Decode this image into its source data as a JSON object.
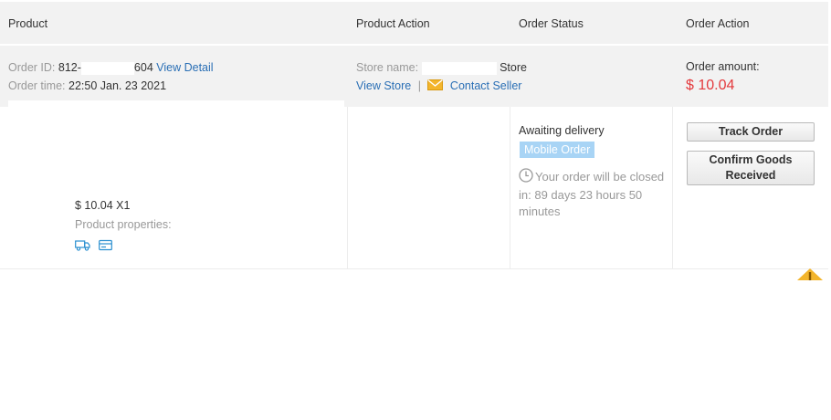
{
  "header": {
    "col_product": "Product",
    "col_product_action": "Product Action",
    "col_order_status": "Order Status",
    "col_order_action": "Order Action"
  },
  "order": {
    "id_label": "Order ID:",
    "id_prefix": "812-",
    "id_suffix": "604",
    "view_detail": "View Detail",
    "time_label": "Order time:",
    "time_value": "22:50 Jan. 23 2021",
    "store_label": "Store name:",
    "store_suffix": "Store",
    "view_store": "View Store",
    "separator": "|",
    "contact_seller": "Contact Seller",
    "amount_label": "Order amount:",
    "amount_value": "$ 10.04"
  },
  "product": {
    "price_qty": "$ 10.04 X1",
    "properties_label": "Product properties:"
  },
  "status": {
    "text": "Awaiting delivery",
    "badge": "Mobile Order",
    "closing_note": "Your order will be closed in: 89 days 23 hours 50 minutes"
  },
  "actions": {
    "track_order": "Track Order",
    "confirm_received": "Confirm Goods Received"
  },
  "colors": {
    "link": "#2a6fb5",
    "amount": "#e4393c",
    "badge": "#a8d4f5",
    "header_bg": "#f2f2f2"
  },
  "icons": [
    "truck-icon",
    "card-icon",
    "mail-icon",
    "clock-icon",
    "warning-icon"
  ]
}
